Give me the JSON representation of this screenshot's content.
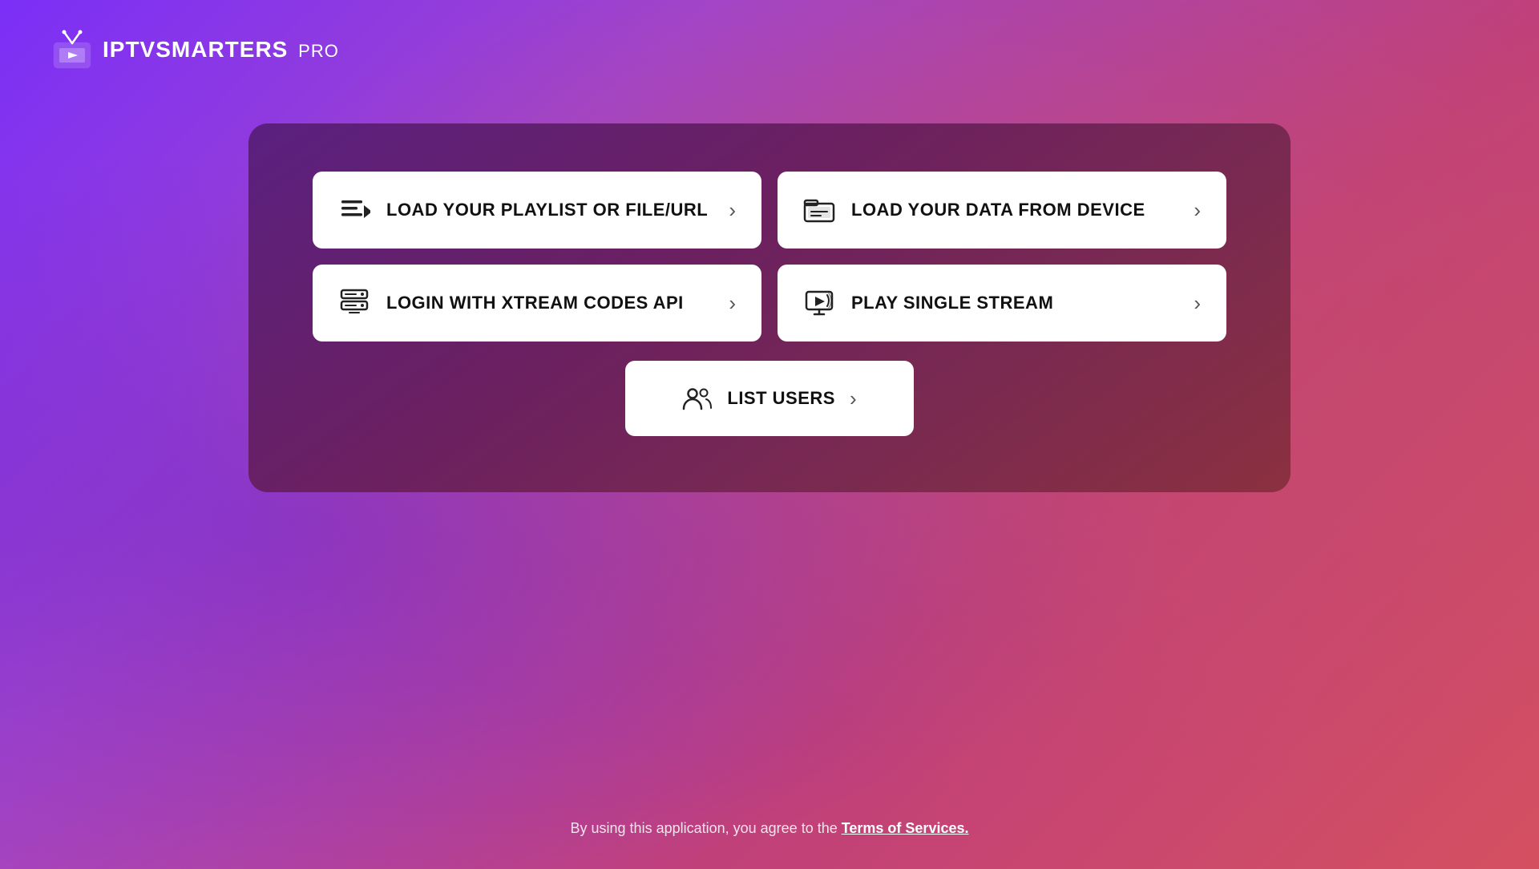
{
  "logo": {
    "iptv_text": "IPTV",
    "smarters_text": "SMARTERS",
    "pro_text": "PRO"
  },
  "card": {
    "options": [
      {
        "id": "playlist",
        "label": "LOAD YOUR PLAYLIST OR FILE/URL",
        "icon": "playlist-icon"
      },
      {
        "id": "device",
        "label": "LOAD YOUR DATA FROM DEVICE",
        "icon": "device-icon"
      },
      {
        "id": "xtream",
        "label": "LOGIN WITH XTREAM CODES API",
        "icon": "xtream-icon"
      },
      {
        "id": "stream",
        "label": "PLAY SINGLE STREAM",
        "icon": "stream-icon"
      }
    ],
    "list_users_label": "LIST USERS"
  },
  "footer": {
    "text": "By using this application, you agree to the ",
    "link_text": "Terms of Services."
  }
}
